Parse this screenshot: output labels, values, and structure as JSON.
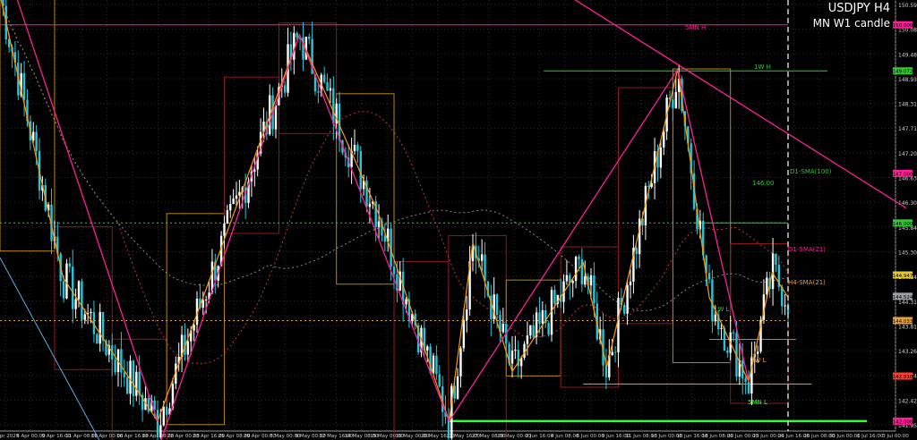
{
  "chart_data": {
    "type": "candlestick",
    "title": "USDJPY H4",
    "subtitle": "MN W1 candle",
    "ylim": [
      141.8,
      150.5
    ],
    "yticks": [
      "150.590",
      "150.080",
      "149.485",
      "148.930",
      "148.310",
      "147.710",
      "147.200",
      "146.630",
      "146.300",
      "145.840",
      "145.300",
      "144.840",
      "144.315",
      "143.810",
      "143.260",
      "142.740",
      "142.425",
      "141.950"
    ],
    "xticks": [
      "1 Apr 2025",
      "4 Apr 00:00",
      "9 Apr 16:00",
      "11 Apr 08:00",
      "15 Apr 00:00",
      "16 Apr 16:00",
      "18 Apr 08:00",
      "22 Apr 00:00",
      "23 Apr 16:00",
      "25 Apr 08:00",
      "29 Apr 00:00",
      "5 May 00:00",
      "9 May 00:00",
      "12 May 16:00",
      "14 May 08:00",
      "15 May 00:00",
      "19 May 00:00",
      "20 May 16:00",
      "22 May 16:00",
      "27 May 08:00",
      "29 May 00:00",
      "2 Jun 16:00",
      "4 Jun 08:00",
      "6 Jun 00:00",
      "9 Jun 16:00",
      "11 Jun 08:00",
      "13 Jun 00:00",
      "16 Jun 16:00",
      "18 Jun 08:00",
      "20 Jun 00:00",
      "23 Jun 00:00",
      "24 Jun 16:00",
      "26 Jun 08:00",
      "30 Jun 00:00",
      "1 Jul 16:00",
      "3 Jul 00:00"
    ],
    "price_tags": [
      {
        "label": "150.000",
        "price": 150.0,
        "color": "#ff1e96"
      },
      {
        "label": "149.072",
        "price": 149.07,
        "color": "#32c832"
      },
      {
        "label": "147.000",
        "price": 147.0,
        "color": "#ff1e96"
      },
      {
        "label": "146.000",
        "price": 146.0,
        "color": "#32c832"
      },
      {
        "label": "144.947",
        "price": 144.95,
        "color": "#e6c832"
      },
      {
        "label": "144.524",
        "price": 144.52,
        "color": "#9aa0a6"
      },
      {
        "label": "144.033",
        "price": 144.03,
        "color": "#e6a040"
      },
      {
        "label": "142.910",
        "price": 142.91,
        "color": "#ff3c32"
      },
      {
        "label": "142.000",
        "price": 142.0,
        "color": "#ff1e96"
      }
    ],
    "levels": [
      {
        "name": "5MN H",
        "price": 150.0,
        "color": "#ff1e96",
        "x1": 0.0,
        "x2": 1.0,
        "style": "solid"
      },
      {
        "name": "1W H",
        "price": 149.07,
        "color": "#32c832",
        "x1": 0.69,
        "x2": 1.05,
        "style": "solid"
      },
      {
        "name": "D1-SMA(100)",
        "price": 146.0,
        "color": "#32c832",
        "x1": 0.88,
        "x2": 1.0,
        "style": "solid"
      },
      {
        "name": "146.00",
        "price": 146.0,
        "color": "#32c832",
        "x1": 0.0,
        "x2": 1.0,
        "style": "dot"
      },
      {
        "name": "H4-SMA(21)",
        "price": 144.03,
        "color": "#e6a040",
        "x1": 0.0,
        "x2": 1.0,
        "style": "dot"
      },
      {
        "name": "1W L",
        "price": 143.65,
        "color": "#32c832",
        "x1": 0.9,
        "x2": 1.01,
        "style": "solid"
      },
      {
        "name": "1W L",
        "price": 142.75,
        "color": "#e6a040",
        "x1": 0.74,
        "x2": 1.03,
        "style": "solid"
      },
      {
        "name": "5MN L",
        "price": 142.0,
        "color": "#32ff32",
        "x1": 0.57,
        "x2": 1.1,
        "style": "solid"
      }
    ],
    "labels": [
      {
        "text": "5MN H",
        "color": "#ff1e96"
      },
      {
        "text": "1W H",
        "color": "#32c832"
      },
      {
        "text": "D1-SMA(100)",
        "color": "#32c832"
      },
      {
        "text": "146.00",
        "color": "#32c832"
      },
      {
        "text": "D1-SMA(21)",
        "color": "#ff1e96"
      },
      {
        "text": "H4-SMA(21)",
        "color": "#e6a040"
      },
      {
        "text": "1W L",
        "color": "#32c832"
      },
      {
        "text": "1W L",
        "color": "#e6a040"
      },
      {
        "text": "5MN L",
        "color": "#32ff32"
      }
    ],
    "swing_points": [
      {
        "t": 0.0,
        "p": 150.6
      },
      {
        "t": 0.08,
        "p": 144.9
      },
      {
        "t": 0.2,
        "p": 142.0
      },
      {
        "t": 0.38,
        "p": 149.8
      },
      {
        "t": 0.48,
        "p": 146.2
      },
      {
        "t": 0.57,
        "p": 142.0
      },
      {
        "t": 0.6,
        "p": 145.6
      },
      {
        "t": 0.65,
        "p": 143.0
      },
      {
        "t": 0.74,
        "p": 145.2
      },
      {
        "t": 0.77,
        "p": 143.1
      },
      {
        "t": 0.86,
        "p": 149.1
      },
      {
        "t": 0.9,
        "p": 144.5
      },
      {
        "t": 0.95,
        "p": 142.8
      },
      {
        "t": 0.98,
        "p": 145.0
      },
      {
        "t": 1.0,
        "p": 144.5
      }
    ],
    "colors": {
      "bull": "#ffffff",
      "bear": "#26c6da",
      "grid": "#2a2a2a",
      "zigzag": "#ff9800",
      "trend": "#ff1e96",
      "box": "#8b1a1a"
    }
  }
}
